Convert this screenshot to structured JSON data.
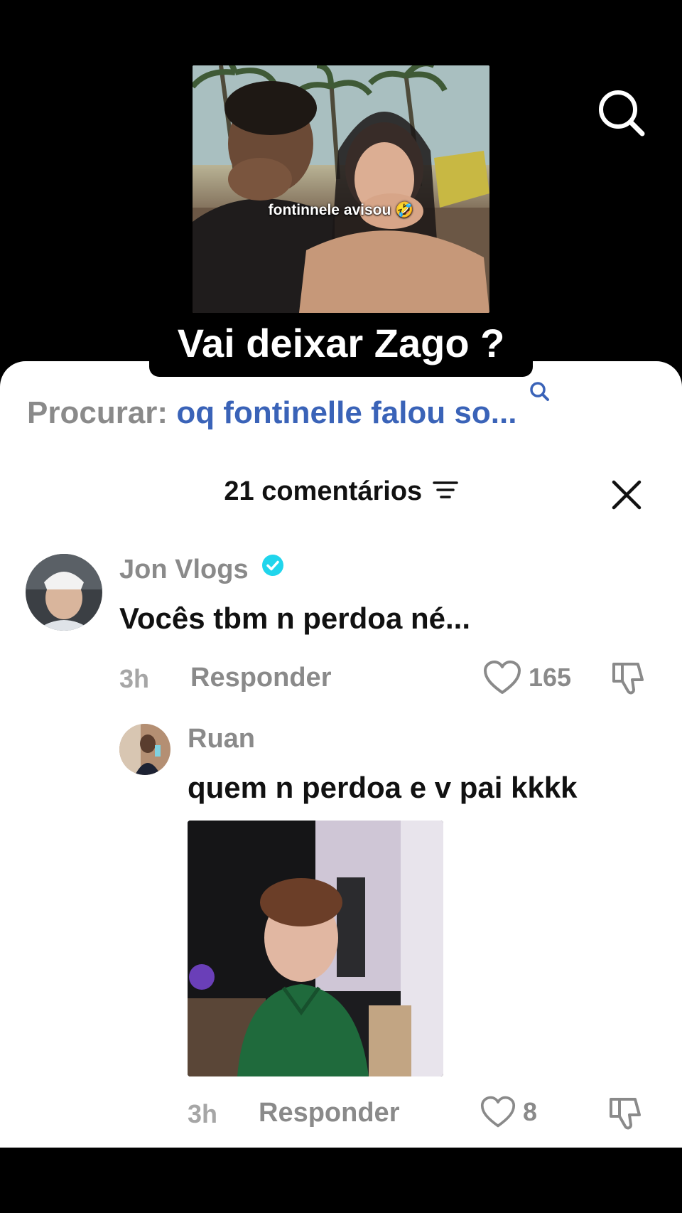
{
  "video": {
    "caption": "fontinnele avisou 🤣",
    "title": "Vai deixar Zago ?"
  },
  "search": {
    "label": "Procurar:",
    "query": "oq fontinelle falou so..."
  },
  "comments_header": {
    "count_label": "21 comentários"
  },
  "comments": [
    {
      "author": "Jon Vlogs",
      "verified": true,
      "text": "Vocês tbm n perdoa né...",
      "time": "3h",
      "reply_label": "Responder",
      "likes": "165"
    }
  ],
  "replies": [
    {
      "author": "Ruan",
      "text": "quem n perdoa e v pai kkkk",
      "time": "3h",
      "reply_label": "Responder",
      "likes": "8"
    }
  ],
  "colors": {
    "accent_blue": "#3a63b8",
    "verified_blue": "#20d5ec",
    "muted_gray": "#8a8a8a"
  }
}
